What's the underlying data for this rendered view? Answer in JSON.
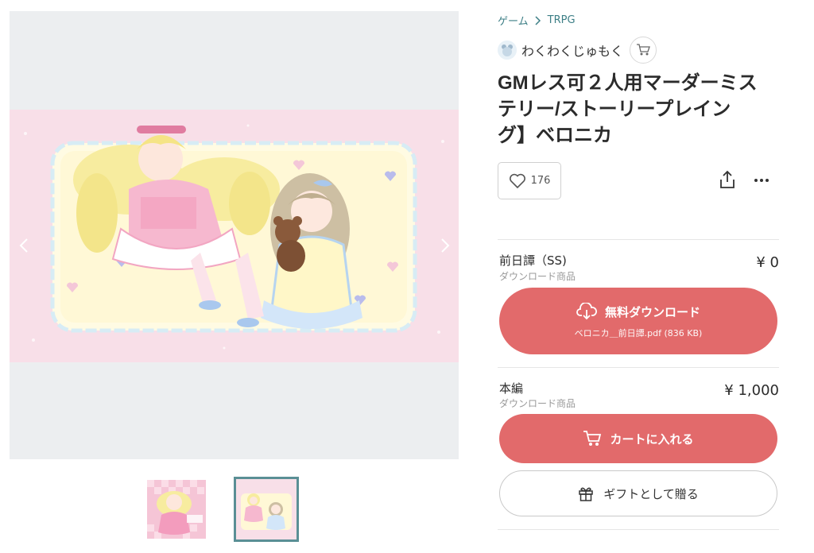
{
  "breadcrumb": {
    "category": "ゲーム",
    "subcategory": "TRPG",
    "separator": ">"
  },
  "shop": {
    "name": "わくわくじゅもく"
  },
  "product": {
    "title": "GMレス可２人用マーダーミステリー/ストーリープレイング】ベロニカ",
    "title_lines": [
      "GMレス可２人用マーダーミス",
      "テリー/ストーリープレイン",
      "グ】ベロニカ"
    ],
    "likes": "176"
  },
  "items": [
    {
      "name": "前日譚（SS)",
      "type": "ダウンロード商品",
      "price": "¥ 0",
      "button_label": "無料ダウンロード",
      "file_label": "ベロニカ＿前日譚.pdf (836 KB)"
    },
    {
      "name": "本編",
      "type": "ダウンロード商品",
      "price": "¥ 1,000",
      "button_label": "カートに入れる"
    }
  ],
  "gift_label": "ギフトとして贈る",
  "colors": {
    "accent": "#e26a6b",
    "link": "#3d7f86",
    "thumb_border": "#5a8f95"
  },
  "icons": [
    "chevron-left-icon",
    "chevron-right-icon",
    "cart-icon",
    "heart-icon",
    "share-icon",
    "more-icon",
    "download-cloud-icon",
    "gift-icon"
  ]
}
